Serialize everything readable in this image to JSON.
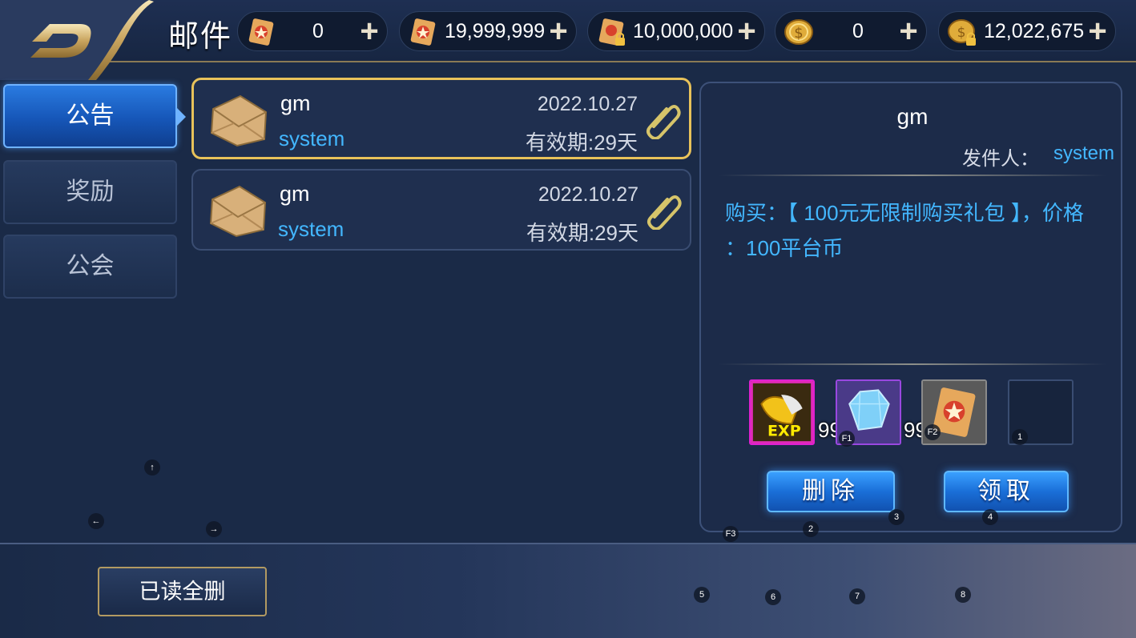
{
  "header": {
    "title": "邮件",
    "currencies": [
      {
        "icon": "scroll-icon",
        "value": "0"
      },
      {
        "icon": "scroll-icon",
        "value": "19,999,999"
      },
      {
        "icon": "locked-scroll-icon",
        "value": "10,000,000"
      },
      {
        "icon": "coin-icon",
        "value": "0"
      },
      {
        "icon": "locked-coin-icon",
        "value": "12,022,675"
      }
    ],
    "plus": "+"
  },
  "tabs": [
    {
      "label": "公告",
      "active": true
    },
    {
      "label": "奖励",
      "active": false
    },
    {
      "label": "公会",
      "active": false
    }
  ],
  "mails": [
    {
      "title": "gm",
      "from": "system",
      "date": "2022.10.27",
      "expire": "有效期:29天",
      "selected": true
    },
    {
      "title": "gm",
      "from": "system",
      "date": "2022.10.27",
      "expire": "有效期:29天",
      "selected": false
    }
  ],
  "detail": {
    "title": "gm",
    "sender_label": "发件人：",
    "sender": "system",
    "body_line1": "购买：【 100元无限制购买礼包 】，价格",
    "body_line2": "：100平台币",
    "rewards": [
      {
        "icon": "exp-capsule-icon",
        "count": "9999999"
      },
      {
        "icon": "diamond-icon",
        "count": "9999999"
      },
      {
        "icon": "scroll-icon",
        "count": ""
      },
      {
        "icon": "empty-slot",
        "count": ""
      }
    ],
    "delete_label": "删除",
    "claim_label": "领取"
  },
  "footer": {
    "delete_read_label": "已读全删"
  },
  "hints": {
    "up": "↑",
    "left": "←",
    "right": "→",
    "f1": "F1",
    "f2": "F2",
    "f3": "F3",
    "n1": "1",
    "n2": "2",
    "n3": "3",
    "n4": "4",
    "n5": "5",
    "n6": "6",
    "n7": "7",
    "n8": "8"
  },
  "colors": {
    "accent_blue": "#43b7ff",
    "selected_border": "#e8c25a",
    "button_blue": "#1a6fd8"
  }
}
